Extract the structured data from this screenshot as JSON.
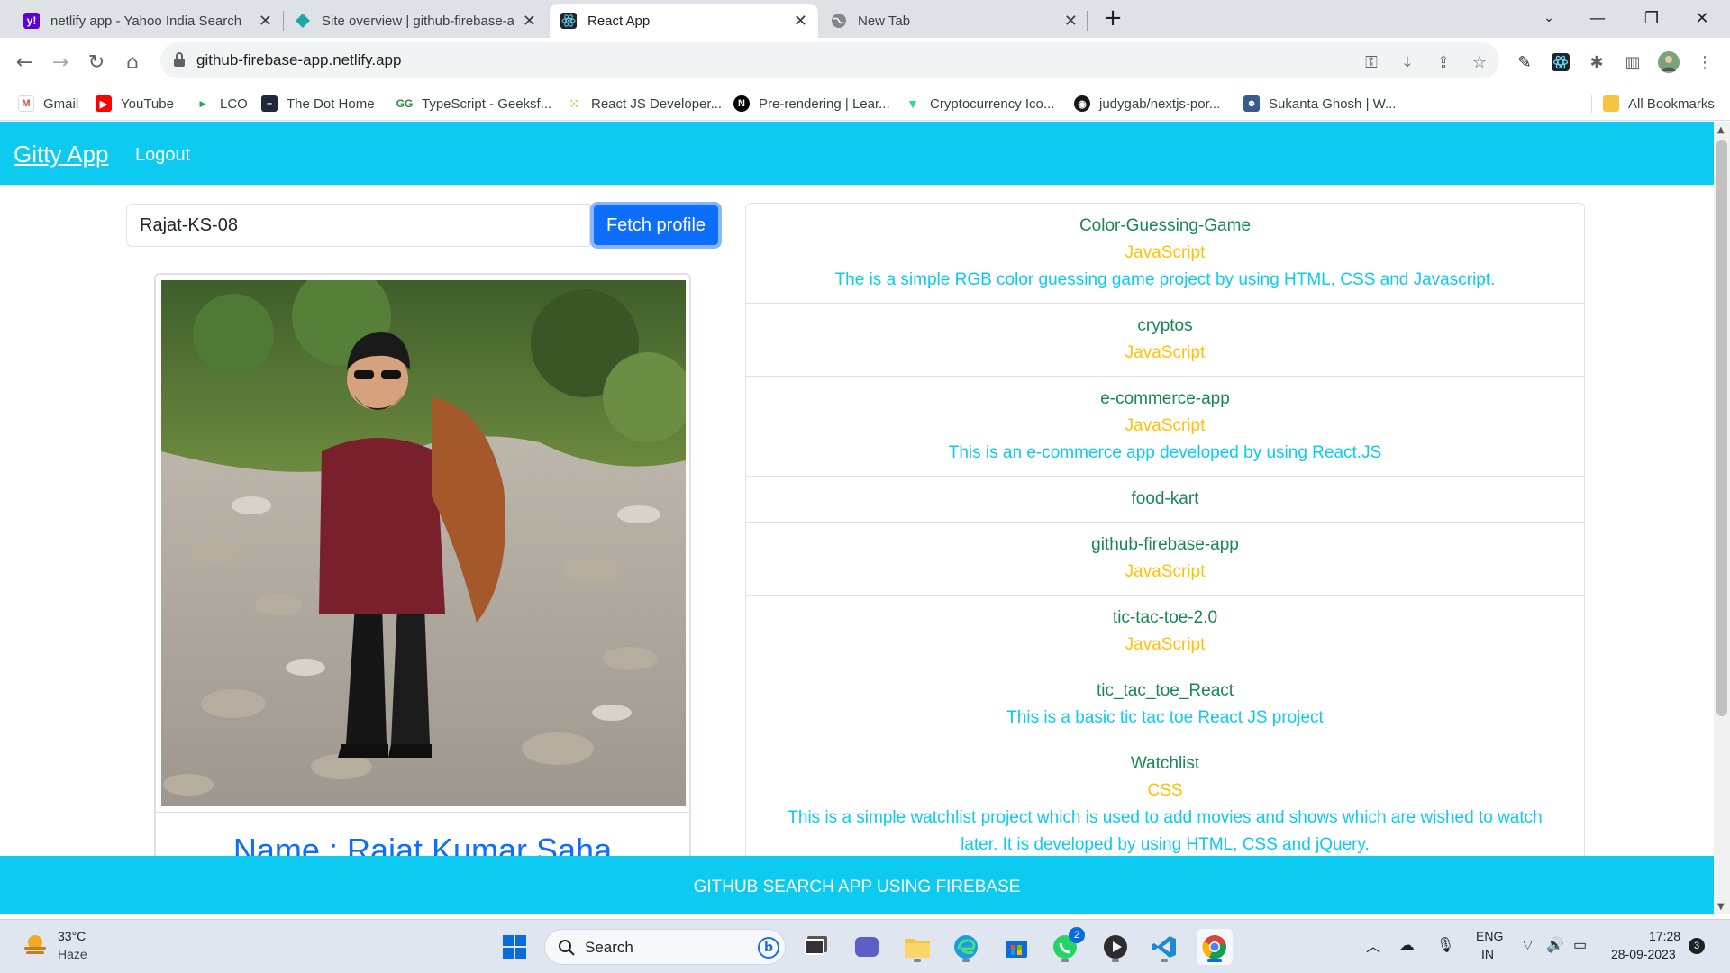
{
  "browser": {
    "tabs": [
      {
        "title": "netlify app - Yahoo India Search",
        "icon": "yahoo-icon",
        "active": false
      },
      {
        "title": "Site overview | github-firebase-a",
        "icon": "netlify-icon",
        "active": false
      },
      {
        "title": "React App",
        "icon": "react-icon",
        "active": true
      },
      {
        "title": "New Tab",
        "icon": "globe-icon",
        "active": false
      }
    ],
    "url": "github-firebase-app.netlify.app",
    "bookmarks": [
      {
        "label": "Gmail",
        "icon": "gmail-icon"
      },
      {
        "label": "YouTube",
        "icon": "youtube-icon"
      },
      {
        "label": "LCO",
        "icon": "play-icon"
      },
      {
        "label": "The Dot Home",
        "icon": "dot-icon"
      },
      {
        "label": "TypeScript - Geeksf...",
        "icon": "gfg-icon"
      },
      {
        "label": "React JS Developer...",
        "icon": "dots-icon"
      },
      {
        "label": "Pre-rendering | Lear...",
        "icon": "nextjs-icon"
      },
      {
        "label": "Cryptocurrency Ico...",
        "icon": "crypto-icon"
      },
      {
        "label": "judygab/nextjs-por...",
        "icon": "github-icon"
      },
      {
        "label": "Sukanta Ghosh | W...",
        "icon": "avatar-icon"
      }
    ],
    "all_bookmarks": "All Bookmarks"
  },
  "app": {
    "brand": "Gitty App",
    "logout": "Logout",
    "search_value": "Rajat-KS-08",
    "fetch_label": "Fetch profile",
    "profile_name": "Name : Rajat Kumar Saha",
    "repos": [
      {
        "name": "Color-Guessing-Game",
        "language": "JavaScript",
        "description": "The is a simple RGB color guessing game project by using HTML, CSS and Javascript."
      },
      {
        "name": "cryptos",
        "language": "JavaScript",
        "description": ""
      },
      {
        "name": "e-commerce-app",
        "language": "JavaScript",
        "description": "This is an e-commerce app developed by using React.JS"
      },
      {
        "name": "food-kart",
        "language": "",
        "description": ""
      },
      {
        "name": "github-firebase-app",
        "language": "JavaScript",
        "description": ""
      },
      {
        "name": "tic-tac-toe-2.0",
        "language": "JavaScript",
        "description": ""
      },
      {
        "name": "tic_tac_toe_React",
        "language": "",
        "description": "This is a basic tic tac toe React JS project"
      },
      {
        "name": "Watchlist",
        "language": "CSS",
        "description": "This is a simple watchlist project which is used to add movies and shows which are wished to watch later. It is developed by using HTML, CSS and jQuery."
      }
    ],
    "footer": "GITHUB SEARCH APP USING FIREBASE",
    "colors": {
      "info": "#0dcaf0",
      "primary": "#0d6efd",
      "success": "#198754",
      "warning": "#ffc107"
    }
  },
  "taskbar": {
    "weather_temp": "33°C",
    "weather_desc": "Haze",
    "search_label": "Search",
    "lang_top": "ENG",
    "lang_bottom": "IN",
    "time": "17:28",
    "date": "28-09-2023",
    "notifications": "3",
    "whatsapp_badge": "2"
  }
}
